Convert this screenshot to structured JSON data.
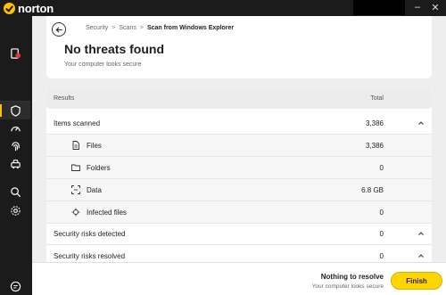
{
  "app": {
    "name": "norton",
    "brand_color": "#ffc200"
  },
  "window": {
    "controls": [
      "minimize",
      "close"
    ]
  },
  "sidebar": {
    "items": [
      {
        "icon": "device-security-icon",
        "active": false
      },
      {
        "icon": "shield-icon",
        "active": true
      },
      {
        "icon": "speedometer-icon",
        "active": false
      },
      {
        "icon": "fingerprint-icon",
        "active": false
      },
      {
        "icon": "car-icon",
        "active": false
      },
      {
        "icon": "search-icon",
        "active": false
      },
      {
        "icon": "gear-icon",
        "active": false
      },
      {
        "icon": "chat-icon",
        "active": false
      }
    ]
  },
  "breadcrumb": {
    "items": [
      "Security",
      "Scans"
    ],
    "current": "Scan from Windows Explorer",
    "separator": ">"
  },
  "header": {
    "title": "No threats found",
    "subtitle": "Your computer looks secure"
  },
  "results": {
    "columns": {
      "name": "Results",
      "total": "Total"
    },
    "items_scanned": {
      "label": "Items scanned",
      "value": "3,386"
    },
    "sub_items": [
      {
        "icon": "file-icon",
        "label": "Files",
        "value": "3,386"
      },
      {
        "icon": "folder-icon",
        "label": "Folders",
        "value": "0"
      },
      {
        "icon": "data-icon",
        "label": "Data",
        "value": "6.8 GB"
      },
      {
        "icon": "infected-icon",
        "label": "Infected files",
        "value": "0"
      }
    ],
    "security_risks_detected": {
      "label": "Security risks detected",
      "value": "0"
    },
    "security_risks_resolved": {
      "label": "Security risks resolved",
      "value": "0"
    }
  },
  "footer": {
    "title": "Nothing to resolve",
    "subtitle": "Your computer looks secure",
    "finish_label": "Finish",
    "button_color": "#ffd500"
  }
}
